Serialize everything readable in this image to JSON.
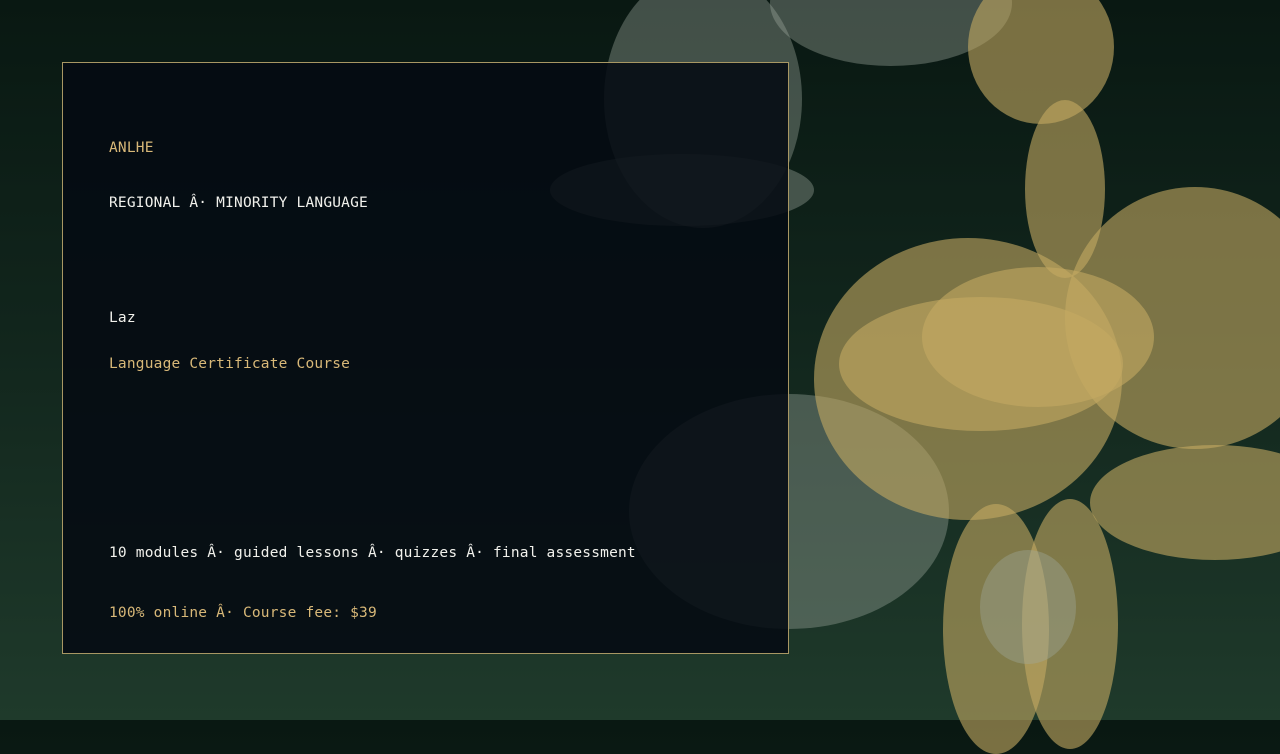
{
  "card": {
    "brand": "ANLHE",
    "category": "REGIONAL Â· MINORITY LANGUAGE",
    "language": "Laz",
    "course_title": "Language Certificate Course",
    "details": "10 modules Â· guided lessons Â· quizzes Â· final assessment",
    "pricing": "100% online Â· Course fee: $39"
  },
  "colors": {
    "background": "#0f231a",
    "panel": "#050a12",
    "panel_border": "#a89763",
    "accent_gold": "#d8b878",
    "text_white": "#f1f1ec"
  }
}
